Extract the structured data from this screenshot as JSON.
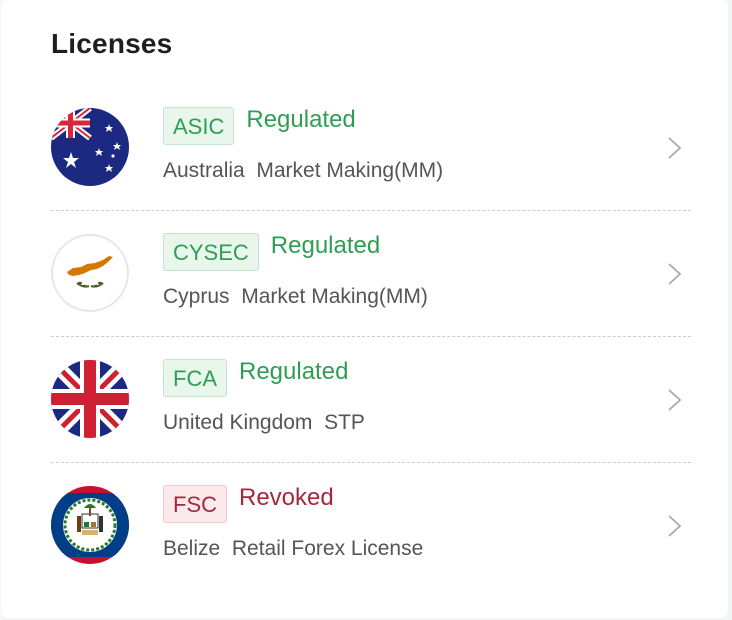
{
  "title": "Licenses",
  "licenses": [
    {
      "agency": "ASIC",
      "status": "Regulated",
      "status_type": "ok",
      "country": "Australia",
      "license_type": "Market Making(MM)",
      "flag_icon": "australia-flag-icon"
    },
    {
      "agency": "CYSEC",
      "status": "Regulated",
      "status_type": "ok",
      "country": "Cyprus",
      "license_type": "Market Making(MM)",
      "flag_icon": "cyprus-flag-icon"
    },
    {
      "agency": "FCA",
      "status": "Regulated",
      "status_type": "ok",
      "country": "United Kingdom",
      "license_type": "STP",
      "flag_icon": "uk-flag-icon"
    },
    {
      "agency": "FSC",
      "status": "Revoked",
      "status_type": "bad",
      "country": "Belize",
      "license_type": "Retail Forex License",
      "flag_icon": "belize-flag-icon"
    }
  ],
  "colors": {
    "regulated": "#2f9e53",
    "revoked": "#a3283f",
    "divider": "#cccccc"
  }
}
